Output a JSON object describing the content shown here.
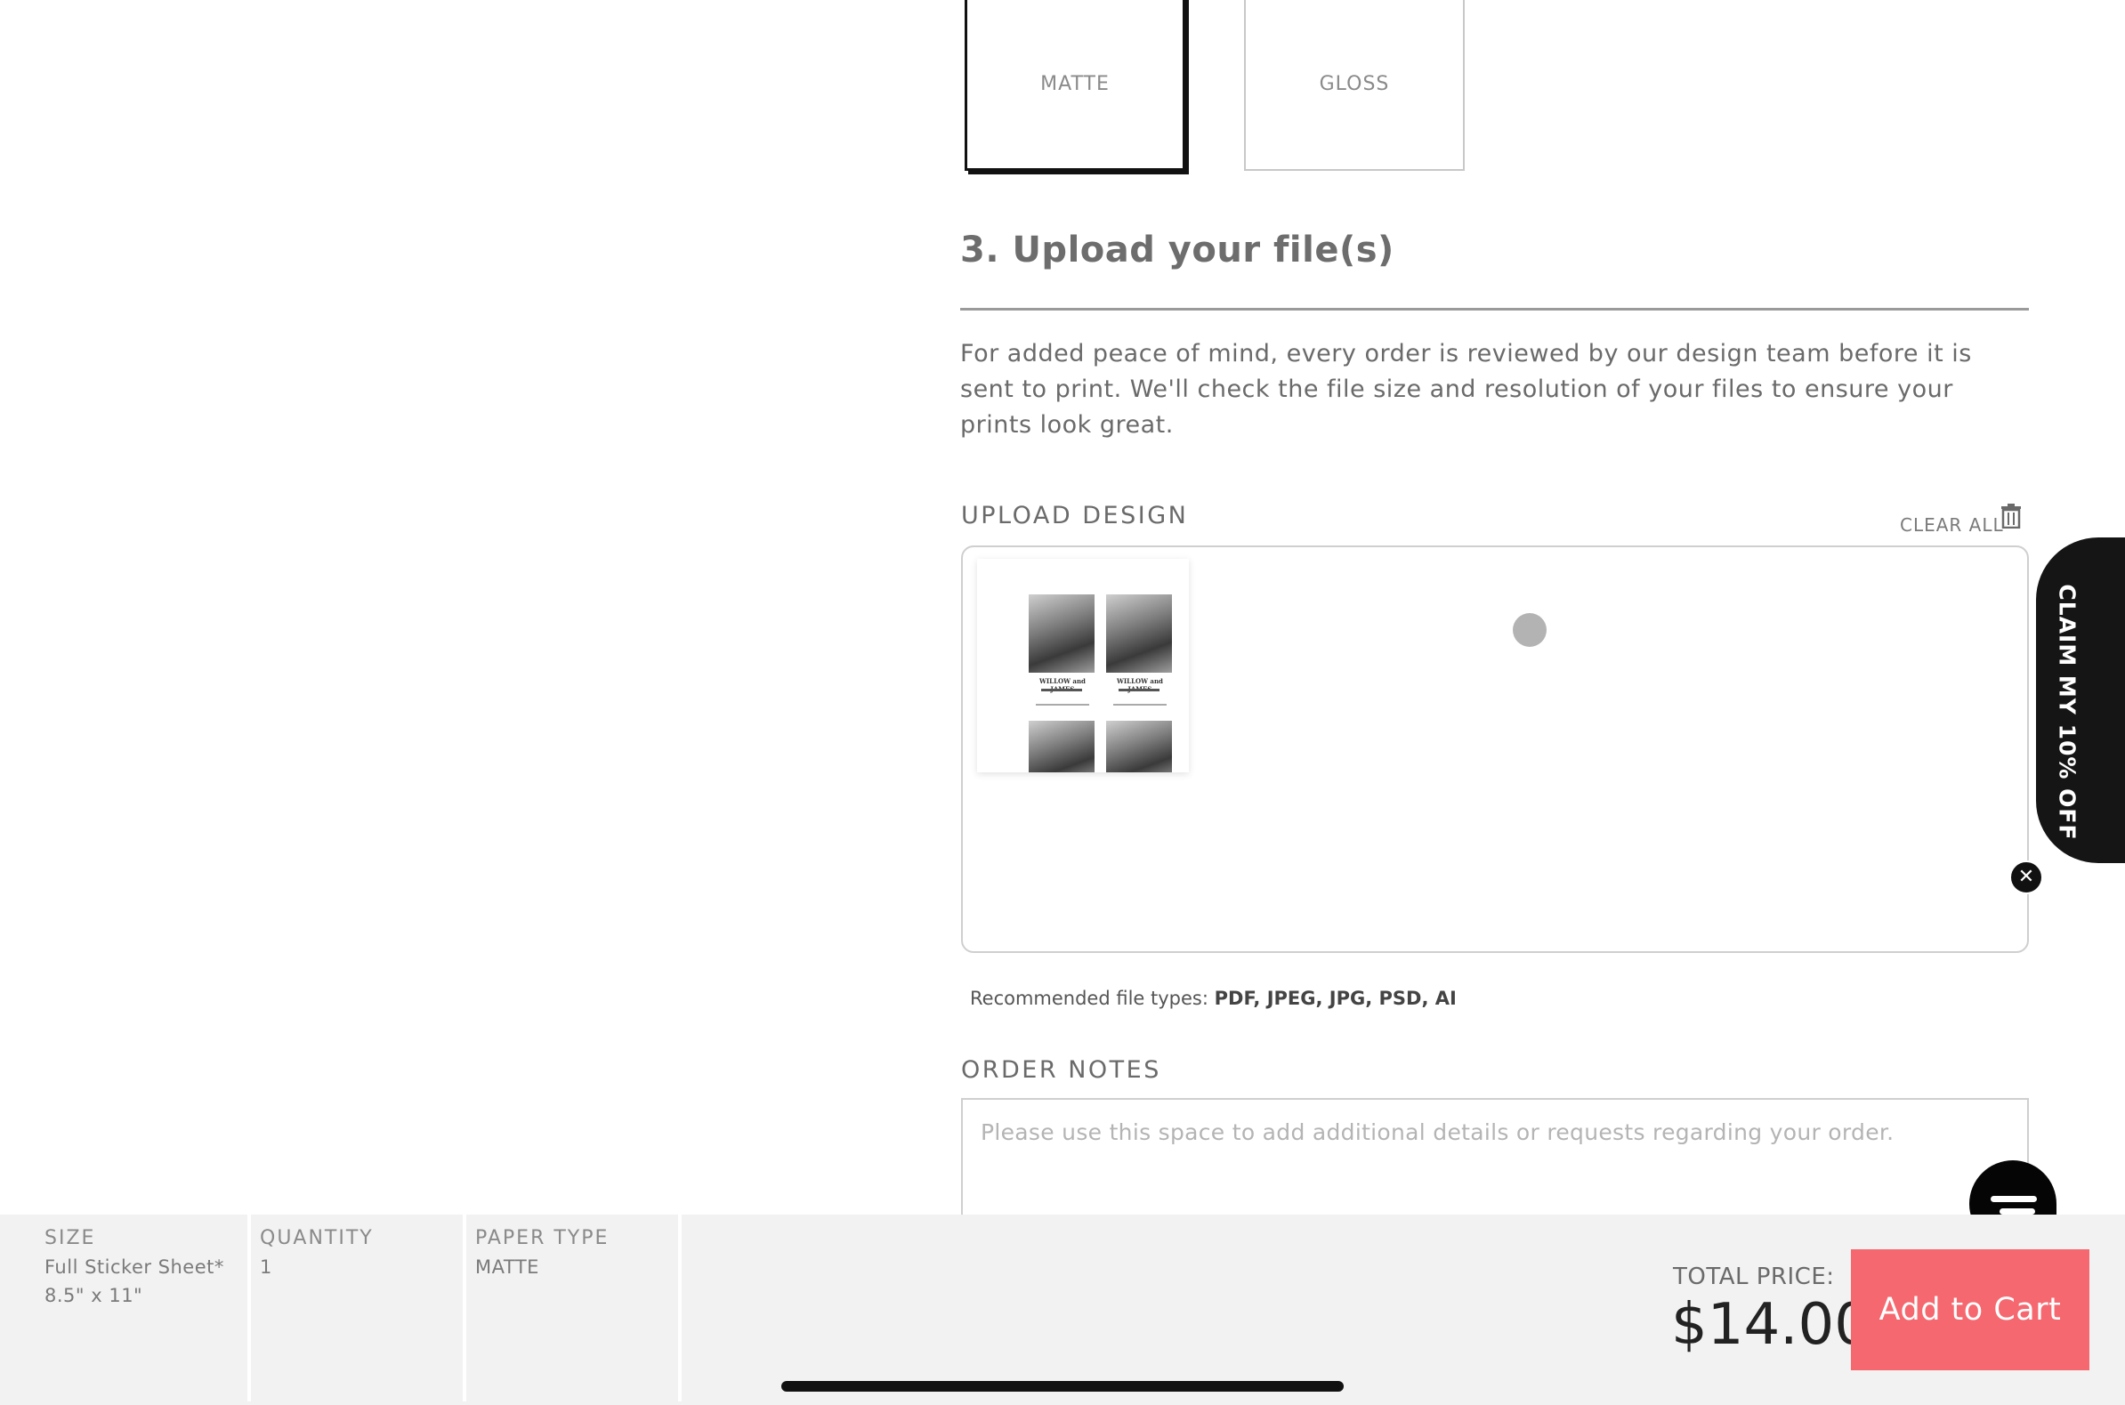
{
  "finish_options": {
    "matte_label": "MATTE",
    "gloss_label": "GLOSS",
    "selected": "MATTE"
  },
  "upload_section": {
    "title": "3. Upload your file(s)",
    "description": "For added peace of mind, every order is reviewed by our design team before it is sent to print. We'll check the file size and resolution of your files to ensure your prints look great.",
    "upload_label": "UPLOAD DESIGN",
    "clear_all_label": "CLEAR ALL",
    "recommended_prefix": "Recommended file types:",
    "recommended_types": "PDF, JPEG, JPG, PSD, AI",
    "thumbnail_text": "WILLOW and JAMES"
  },
  "order_notes": {
    "label": "ORDER NOTES",
    "placeholder": "Please use this space to add additional details or requests regarding your order."
  },
  "promo": {
    "label": "CLAIM MY 10% OFF",
    "close_icon": "close-icon"
  },
  "summary": {
    "size_label": "SIZE",
    "size_value_1": "Full Sticker Sheet*",
    "size_value_2": "8.5\" x 11\"",
    "quantity_label": "QUANTITY",
    "quantity_value": "1",
    "paper_label": "PAPER TYPE",
    "paper_value": "MATTE",
    "total_label": "TOTAL PRICE:",
    "total_value": "$14.00",
    "cart_button": "Add to Cart"
  },
  "colors": {
    "accent": "#f5686f",
    "dark": "#151515",
    "bar_bg": "#f2f2f2"
  }
}
